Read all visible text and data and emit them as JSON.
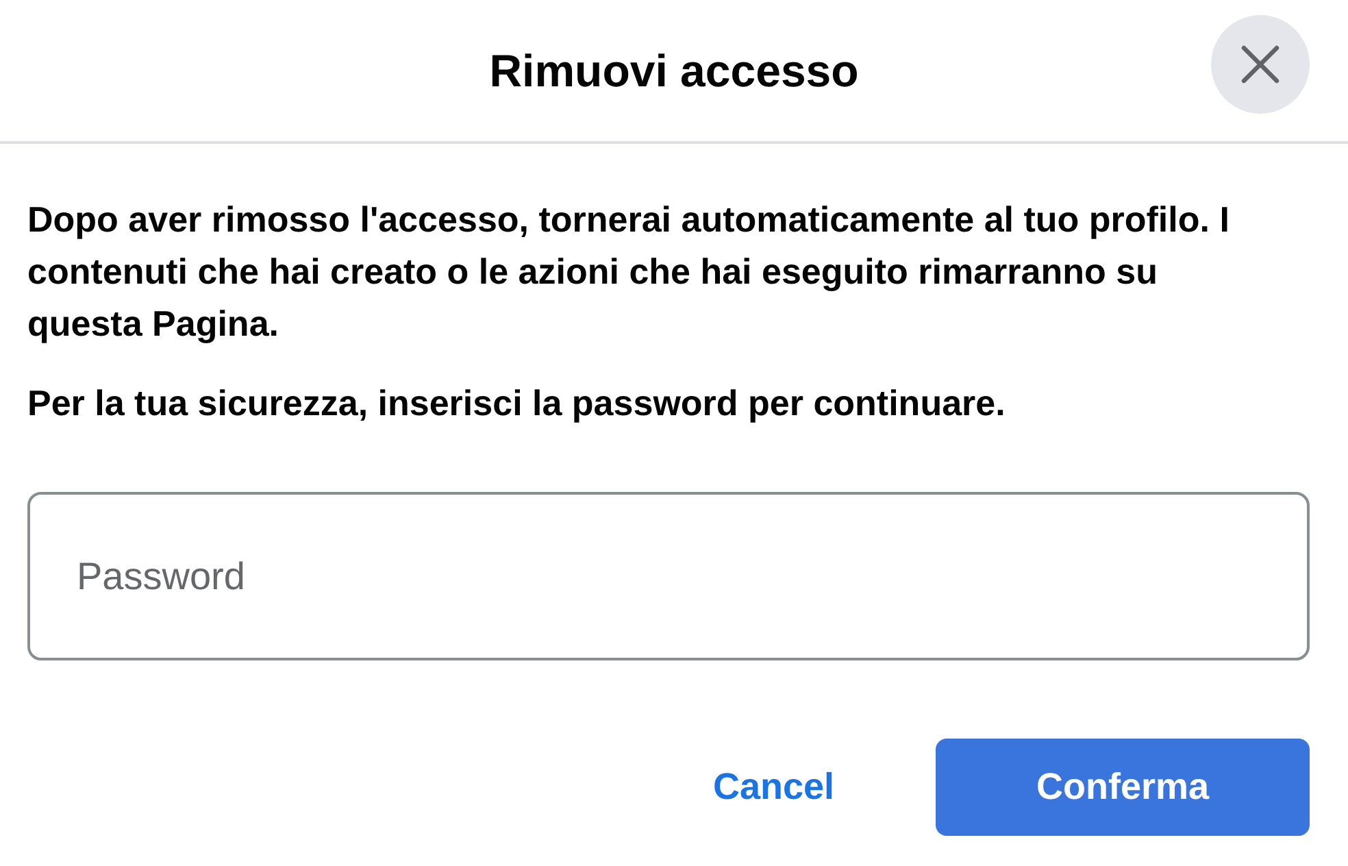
{
  "dialog": {
    "title": "Rimuovi accesso"
  },
  "paragraphs": [
    "Dopo aver rimosso l'accesso, tornerai automaticamente al tuo profilo. I contenuti che hai creato o le azioni che hai eseguito rimarranno su questa Pagina.",
    "Per la tua sicurezza, inserisci la password per continuare."
  ],
  "password_field": {
    "placeholder": "Password"
  },
  "buttons": [
    {
      "label": "Cancel",
      "kind": "link"
    },
    {
      "label": "Conferma",
      "kind": "primary"
    }
  ]
}
